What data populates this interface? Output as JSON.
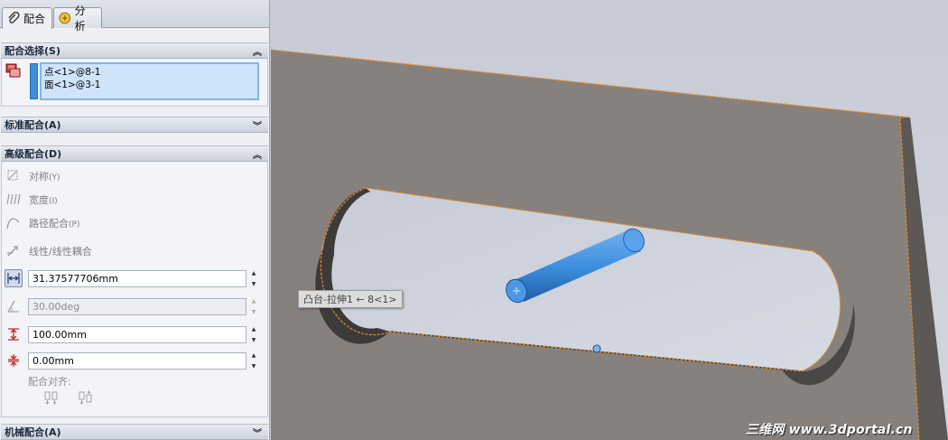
{
  "tabs": [
    {
      "label": "配合",
      "icon": "paperclip-icon"
    },
    {
      "label": "分析",
      "icon": "analysis-icon"
    }
  ],
  "mate_selection": {
    "header": "配合选择(S)",
    "items": [
      "点<1>@8-1",
      "面<1>@3-1"
    ]
  },
  "standard_mates": {
    "header": "标准配合(A)"
  },
  "advanced_mates": {
    "header": "高级配合(D)",
    "options": [
      {
        "label": "对称",
        "shortcut": "(Y)",
        "icon": "symmetric-icon"
      },
      {
        "label": "宽度",
        "shortcut": "(I)",
        "icon": "width-icon"
      },
      {
        "label": "路径配合",
        "shortcut": "(P)",
        "icon": "path-mate-icon"
      },
      {
        "label": "线性/线性耦合",
        "shortcut": "",
        "icon": "linear-coupler-icon"
      }
    ],
    "distance_value": "31.37577706mm",
    "angle_value": "30.00deg",
    "max_value": "100.00mm",
    "min_value": "0.00mm",
    "mate_alignment_label": "配合对齐:"
  },
  "mechanical_mates": {
    "header": "机械配合(A)"
  },
  "viewport": {
    "tooltip": "凸台-拉伸1 ← 8<1>",
    "watermark": "三维网 www.3dportal.cn"
  },
  "colors": {
    "plate": "#86817d",
    "slot_face": "#ccd1dc",
    "pin": "#3f8fdf",
    "edge_highlight": "#e08a2a",
    "background": "#c9ccd6"
  }
}
